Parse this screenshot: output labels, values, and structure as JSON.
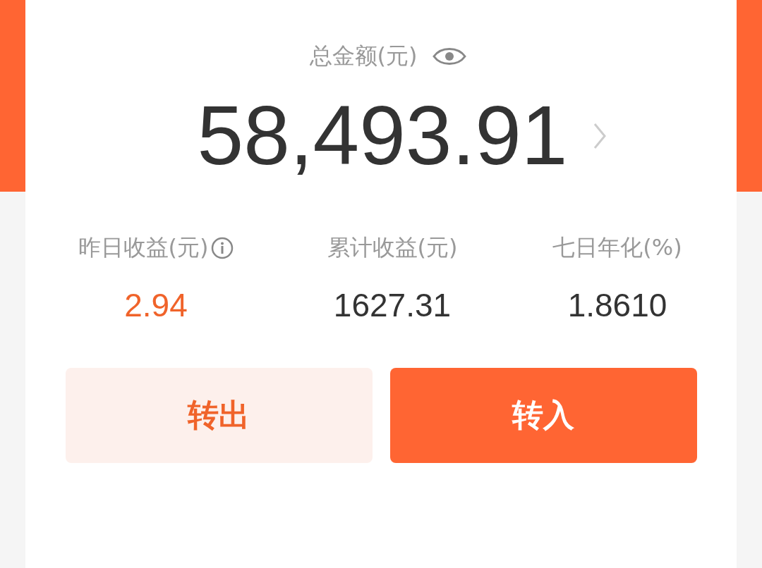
{
  "balance": {
    "label": "总金额(元)",
    "amount": "58,493.91"
  },
  "stats": [
    {
      "label": "昨日收益(元)",
      "value": "2.94",
      "highlight": true,
      "info": true
    },
    {
      "label": "累计收益(元)",
      "value": "1627.31",
      "highlight": false,
      "info": false
    },
    {
      "label": "七日年化(%)",
      "value": "1.8610",
      "highlight": false,
      "info": false
    }
  ],
  "buttons": [
    {
      "label": "转出",
      "kind": "secondary"
    },
    {
      "label": "转入",
      "kind": "primary"
    }
  ]
}
